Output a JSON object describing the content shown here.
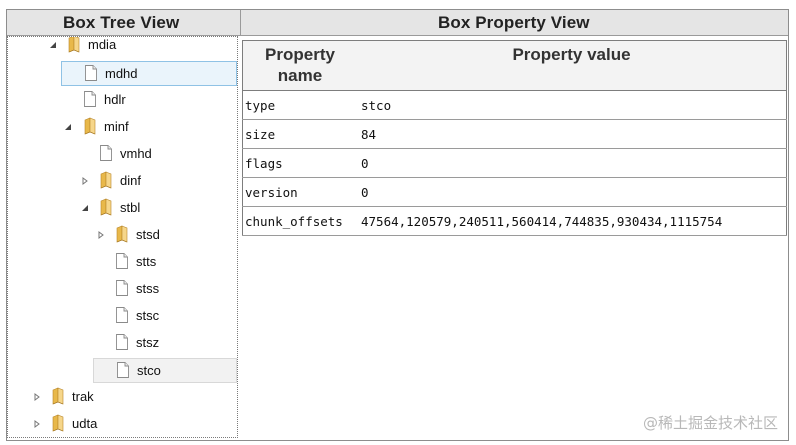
{
  "panels": {
    "tree_title": "Box Tree View",
    "property_title": "Box Property View"
  },
  "tree": {
    "nodes": [
      {
        "label": "mdia",
        "icon": "folder-icon",
        "toggle": "expanded",
        "state": "normal"
      },
      {
        "label": "mdhd",
        "icon": "file-icon",
        "toggle": "none",
        "state": "selected"
      },
      {
        "label": "hdlr",
        "icon": "file-icon",
        "toggle": "none",
        "state": "normal"
      },
      {
        "label": "minf",
        "icon": "folder-icon",
        "toggle": "expanded",
        "state": "normal"
      },
      {
        "label": "vmhd",
        "icon": "file-icon",
        "toggle": "none",
        "state": "normal"
      },
      {
        "label": "dinf",
        "icon": "folder-icon",
        "toggle": "collapsed",
        "state": "normal"
      },
      {
        "label": "stbl",
        "icon": "folder-icon",
        "toggle": "expanded",
        "state": "normal"
      },
      {
        "label": "stsd",
        "icon": "folder-icon",
        "toggle": "collapsed",
        "state": "normal"
      },
      {
        "label": "stts",
        "icon": "file-icon",
        "toggle": "none",
        "state": "normal"
      },
      {
        "label": "stss",
        "icon": "file-icon",
        "toggle": "none",
        "state": "normal"
      },
      {
        "label": "stsc",
        "icon": "file-icon",
        "toggle": "none",
        "state": "normal"
      },
      {
        "label": "stsz",
        "icon": "file-icon",
        "toggle": "none",
        "state": "normal"
      },
      {
        "label": "stco",
        "icon": "file-icon",
        "toggle": "none",
        "state": "hovered"
      },
      {
        "label": "trak",
        "icon": "folder-icon",
        "toggle": "collapsed",
        "state": "normal"
      },
      {
        "label": "udta",
        "icon": "folder-icon",
        "toggle": "collapsed",
        "state": "normal"
      }
    ]
  },
  "properties": {
    "header_name": "Property name",
    "header_value": "Property value",
    "rows": [
      {
        "name": "type",
        "value": "stco"
      },
      {
        "name": "size",
        "value": "84"
      },
      {
        "name": "flags",
        "value": "0"
      },
      {
        "name": "version",
        "value": "0"
      },
      {
        "name": "chunk_offsets",
        "value": "47564,120579,240511,560414,744835,930434,1115754"
      }
    ]
  },
  "watermark": "@稀土掘金技术社区",
  "colors": {
    "selected_bg": "#eaf4fb",
    "selected_border": "#8fc2e5",
    "folder": "#e8b84a",
    "header_bg": "#e5e5e5"
  }
}
